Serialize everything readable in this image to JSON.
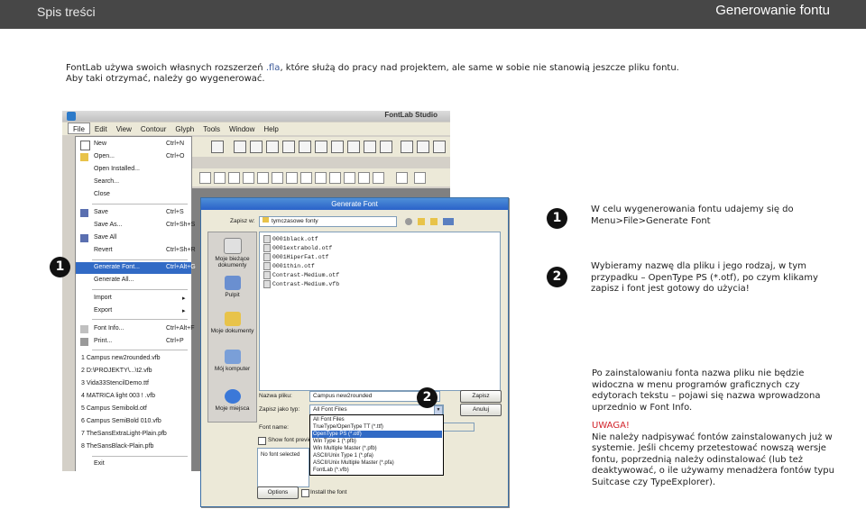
{
  "header": {
    "section": "Spis treści",
    "title": "Generowanie fontu"
  },
  "intro": {
    "line1_before": "FontLab używa swoich własnych rozszerzeń ",
    "ext": ".fla",
    "line1_after": ", które służą do pracy nad projektem, ale same w sobie nie stanowią jeszcze pliku fontu.",
    "line2": "Aby taki otrzymać, należy go wygenerować."
  },
  "markers": {
    "one": "1",
    "two": "2"
  },
  "steps": [
    {
      "text": "W celu wygenerowania fontu udajemy się do Menu>File>Generate Font"
    },
    {
      "text": "Wybieramy nazwę dla pliku i jego rodzaj, w tym przypadku – OpenType PS (*.otf), po czym klikamy zapisz i font jest gotowy do użycia!"
    }
  ],
  "note": {
    "p1": "Po zainstalowaniu fonta nazwa pliku nie będzie widoczna w menu programów graficznych czy edytorach tekstu – pojawi się nazwa wprowadzona uprzednio w Font Info.",
    "warn": "UWAGA!",
    "p2": "Nie należy nadpisywać fontów zainstalowanych już w systemie. Jeśli chcemy przetestować nowszą wersje fontu, poprzednią należy odinstalować (lub też deaktywować, o ile używamy menadżera fontów typu Suitcase czy TypeExplorer)."
  },
  "app": {
    "title": "FontLab Studio",
    "menubar": [
      "File",
      "Edit",
      "View",
      "Contour",
      "Glyph",
      "Tools",
      "Window",
      "Help"
    ],
    "file_menu": [
      {
        "label": "New",
        "shortcut": "Ctrl+N"
      },
      {
        "label": "Open...",
        "shortcut": "Ctrl+O"
      },
      {
        "label": "Open Installed...",
        "shortcut": ""
      },
      {
        "label": "Search...",
        "shortcut": ""
      },
      {
        "label": "Close",
        "shortcut": ""
      },
      {
        "label": "Save",
        "shortcut": "Ctrl+S"
      },
      {
        "label": "Save As...",
        "shortcut": "Ctrl+Sh+S"
      },
      {
        "label": "Save All",
        "shortcut": ""
      },
      {
        "label": "Revert",
        "shortcut": "Ctrl+Sh+R"
      },
      {
        "label": "Generate Font...",
        "shortcut": "Ctrl+Alt+G"
      },
      {
        "label": "Generate All...",
        "shortcut": ""
      },
      {
        "label": "Import",
        "shortcut": "▸"
      },
      {
        "label": "Export",
        "shortcut": "▸"
      },
      {
        "label": "Font Info...",
        "shortcut": "Ctrl+Alt+F"
      },
      {
        "label": "Print...",
        "shortcut": "Ctrl+P"
      },
      {
        "label": "1 Campus new2rounded.vfb",
        "shortcut": ""
      },
      {
        "label": "2 D:\\PROJEKTY\\...\\t2.vfb",
        "shortcut": ""
      },
      {
        "label": "3 Vida33StencilDemo.ttf",
        "shortcut": ""
      },
      {
        "label": "4 MATRICA light 003 ! .vfb",
        "shortcut": ""
      },
      {
        "label": "5 Campus Semibold.otf",
        "shortcut": ""
      },
      {
        "label": "6 Campus SemiBold 010.vfb",
        "shortcut": ""
      },
      {
        "label": "7 TheSansExtraLight-Plain.pfb",
        "shortcut": ""
      },
      {
        "label": "8 TheSansBlack-Plain.pfb",
        "shortcut": ""
      },
      {
        "label": "Exit",
        "shortcut": ""
      }
    ]
  },
  "dialog": {
    "title": "Generate Font",
    "save_in_label": "Zapisz w:",
    "save_in_value": "tymczasowe fonty",
    "places": [
      "Moje bieżące dokumenty",
      "Pulpit",
      "Moje dokumenty",
      "Mój komputer",
      "Moje miejsca"
    ],
    "files": [
      "0001black.otf",
      "0001extrabold.otf",
      "0001HiperFat.otf",
      "0001thin.otf",
      "Contrast-Medium.otf",
      "Contrast-Medium.vfb"
    ],
    "filename_label": "Nazwa pliku:",
    "filename_value": "Campus new2rounded",
    "type_label": "Zapisz jako typ:",
    "type_value": "All Font Files",
    "fontname_label": "Font name:",
    "show_preview": "Show font previe",
    "no_font": "No font selected",
    "save_btn": "Zapisz",
    "cancel_btn": "Anuluj",
    "options_btn": "Options",
    "install_label": "Install the font",
    "types": [
      "All Font Files",
      "TrueType/OpenType TT (*.ttf)",
      "OpenType PS (*.otf)",
      "Win Type 1 (*.pfb)",
      "Win Multiple Master (*.pfb)",
      "ASCII/Unix Type 1 (*.pfa)",
      "ASCII/Unix Multiple Master (*.pfa)",
      "FontLab (*.vfb)"
    ]
  }
}
